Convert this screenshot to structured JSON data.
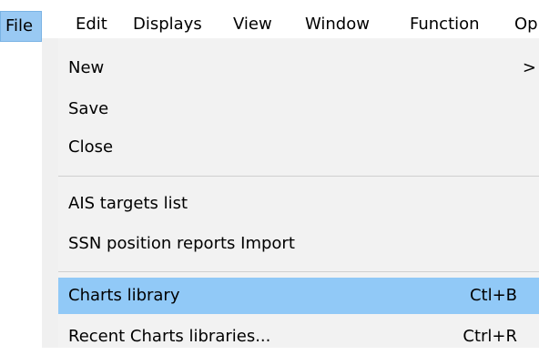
{
  "menubar": {
    "items": [
      {
        "label": "File"
      },
      {
        "label": "Edit"
      },
      {
        "label": "Displays"
      },
      {
        "label": "View"
      },
      {
        "label": "Window"
      },
      {
        "label": "Function"
      },
      {
        "label": "Op"
      }
    ]
  },
  "file_menu": {
    "items": [
      {
        "label": "New",
        "submenu_arrow": ">"
      },
      {
        "label": "Save"
      },
      {
        "label": "Close"
      },
      {
        "label": "AIS targets list"
      },
      {
        "label": "SSN position reports Import"
      },
      {
        "label": "Charts library",
        "shortcut": "Ctl+B"
      },
      {
        "label": "Recent Charts libraries...",
        "shortcut": "Ctrl+R"
      }
    ]
  },
  "colors": {
    "highlight": "#91c9f7",
    "menubar_active": "#99c9f3",
    "menu_background": "#f2f2f2",
    "separator": "#d0d0d0"
  }
}
